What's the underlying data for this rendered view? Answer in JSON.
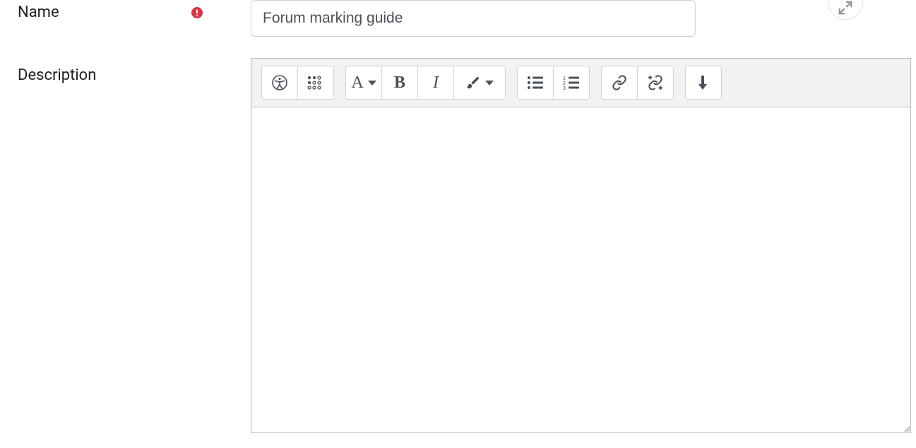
{
  "form": {
    "name": {
      "label": "Name",
      "value": "Forum marking guide",
      "required": true
    },
    "description": {
      "label": "Description",
      "value": ""
    }
  },
  "editor": {
    "toolbar": {
      "accessibility": "accessibility-checker",
      "screenreader": "screenreader-helper",
      "paragraph": "paragraph-styles",
      "bold": "bold",
      "italic": "italic",
      "color": "text-color",
      "ul": "unordered-list",
      "ol": "ordered-list",
      "link": "link",
      "unlink": "unlink",
      "more": "show-more-buttons"
    }
  },
  "fullscreen": "toggle-fullscreen"
}
